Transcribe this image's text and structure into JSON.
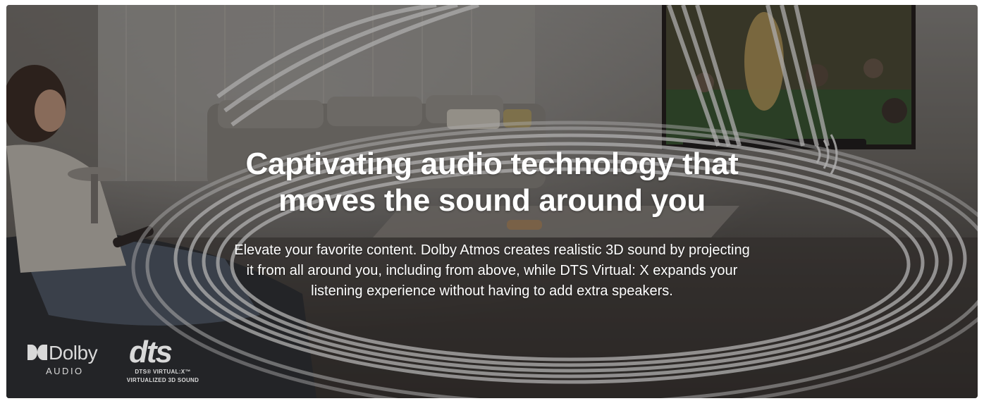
{
  "hero": {
    "headline_lines": [
      "Captivating audio technology that",
      "moves the sound around you"
    ],
    "description_lines": [
      "Elevate your favorite content. Dolby Atmos creates realistic 3D sound by projecting",
      "it from all around you, including from above, while DTS Virtual: X expands your",
      "listening experience without having to add extra speakers."
    ]
  },
  "logos": {
    "dolby": {
      "wordmark": "Dolby",
      "subtitle": "AUDIO",
      "icon": "dolby-double-d-icon"
    },
    "dts": {
      "wordmark": "dts",
      "subtitle_line1": "DTS® VIRTUAL:X™",
      "subtitle_line2": "VIRTUALIZED 3D SOUND"
    }
  },
  "colors": {
    "text": "#ffffff",
    "logo": "#d9d9d9",
    "sound_wave": "#ffffff"
  }
}
